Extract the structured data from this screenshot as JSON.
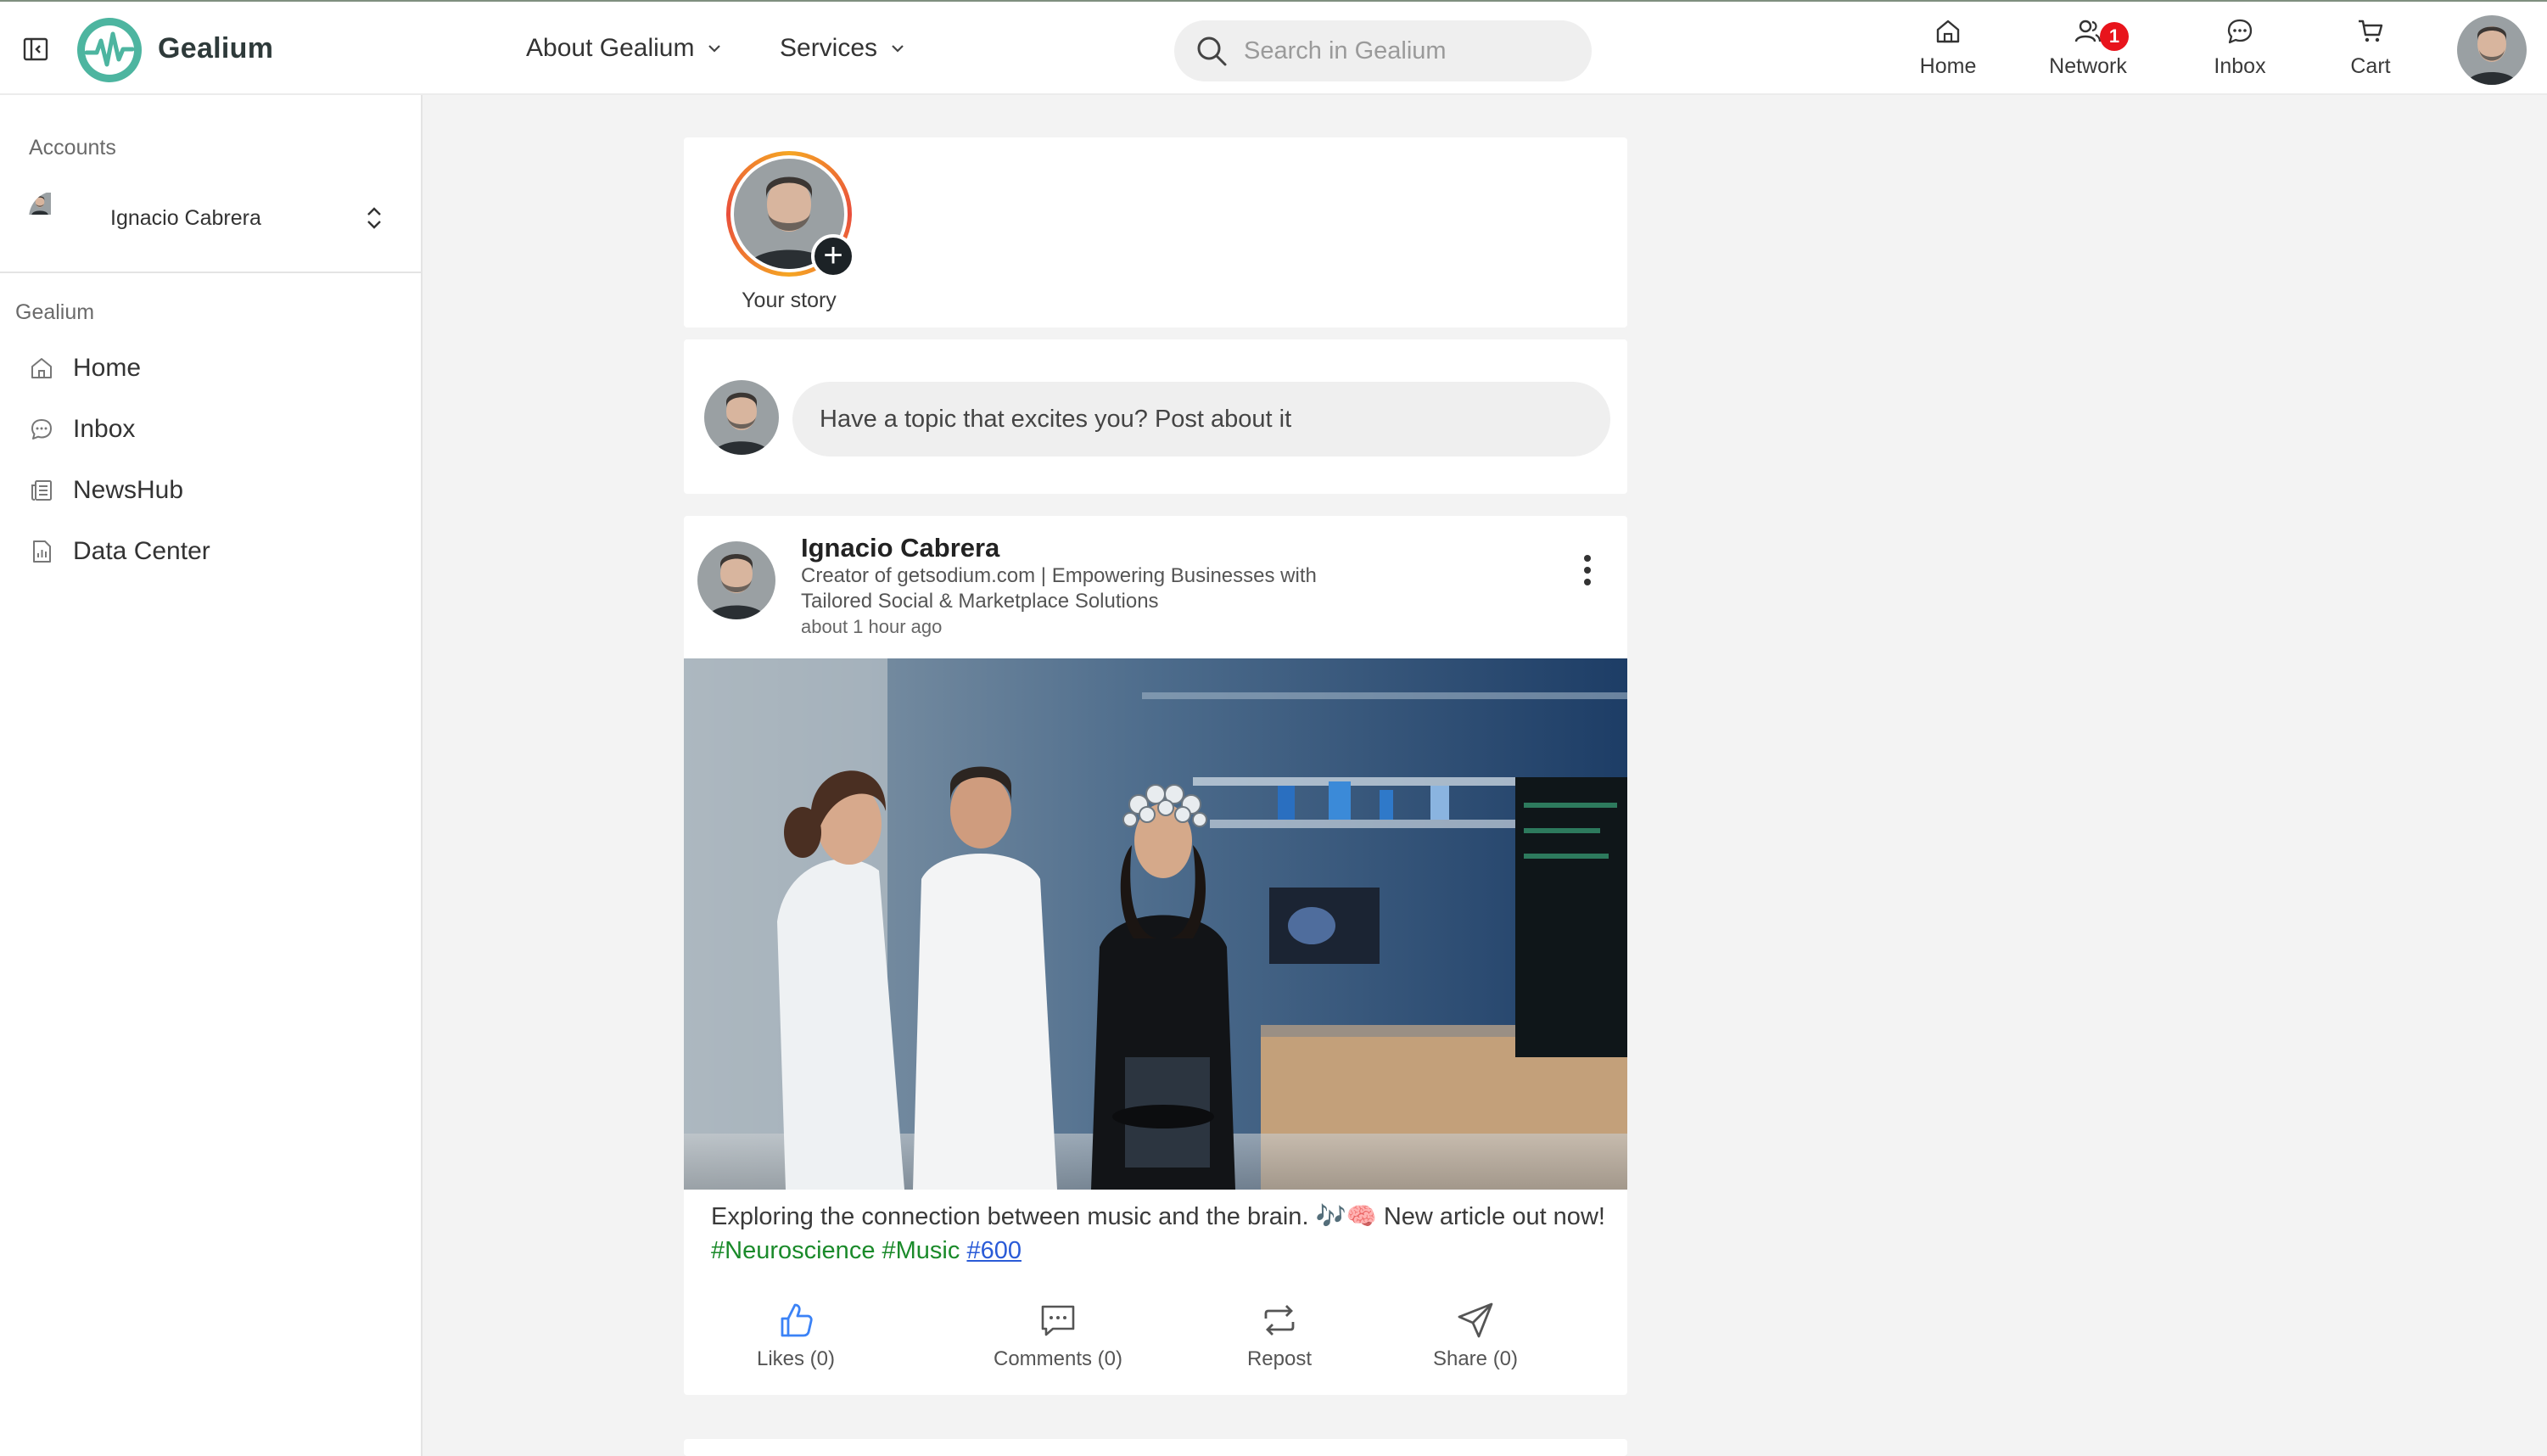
{
  "brand": {
    "name": "Gealium",
    "accent": "#4db5a0",
    "badge_color": "#e8141c"
  },
  "topnav": {
    "about_label": "About Gealium",
    "services_label": "Services",
    "search_placeholder": "Search in Gealium"
  },
  "icon_nav": [
    {
      "label": "Home",
      "icon": "home-icon"
    },
    {
      "label": "Network",
      "icon": "network-icon",
      "badge": "1"
    },
    {
      "label": "Inbox",
      "icon": "chat-icon"
    },
    {
      "label": "Cart",
      "icon": "cart-icon"
    }
  ],
  "sidebar": {
    "accounts_heading": "Accounts",
    "account_name": "Ignacio Cabrera",
    "section_heading": "Gealium",
    "items": [
      {
        "label": "Home",
        "icon": "home-icon"
      },
      {
        "label": "Inbox",
        "icon": "chat-icon"
      },
      {
        "label": "NewsHub",
        "icon": "news-icon"
      },
      {
        "label": "Data Center",
        "icon": "report-icon"
      }
    ]
  },
  "stories": {
    "your_story_label": "Your story"
  },
  "composer": {
    "placeholder": "Have a topic that excites you? Post about it"
  },
  "post": {
    "author": "Ignacio Cabrera",
    "bio": "Creator of getsodium.com | Empowering Businesses with Tailored Social & Marketplace Solutions",
    "time": "about 1 hour ago",
    "text": "Exploring the connection between music and the brain. 🎶🧠 New article out now! ",
    "hashtags": [
      "#Neuroscience",
      "#Music"
    ],
    "link_tag": "#600",
    "actions": {
      "likes": "Likes (0)",
      "comments": "Comments (0)",
      "repost": "Repost",
      "share": "Share (0)"
    }
  }
}
